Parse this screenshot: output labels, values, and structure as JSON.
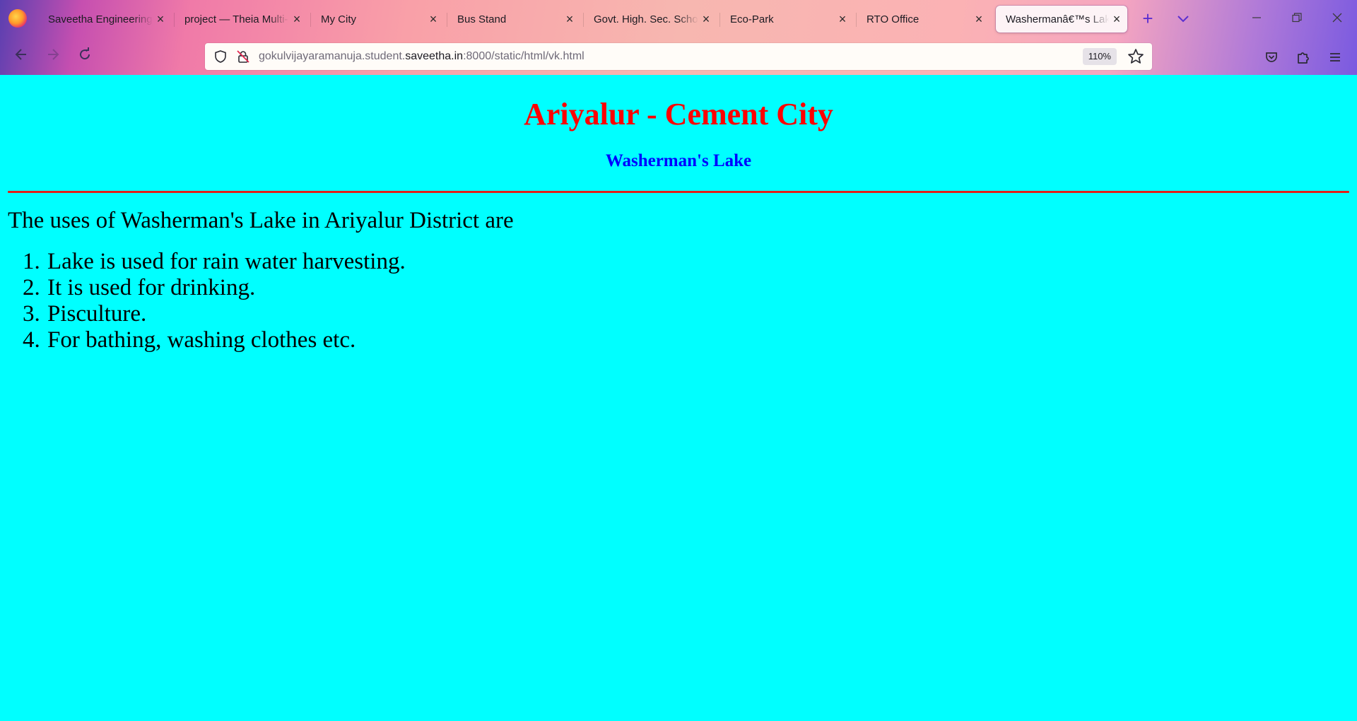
{
  "browser": {
    "tabs": [
      {
        "label": "Saveetha Engineering College",
        "active": false
      },
      {
        "label": "project — Theia Multi-Language",
        "active": false
      },
      {
        "label": "My City",
        "active": false
      },
      {
        "label": "Bus Stand",
        "active": false
      },
      {
        "label": "Govt. High. Sec. School",
        "active": false
      },
      {
        "label": "Eco-Park",
        "active": false
      },
      {
        "label": "RTO Office",
        "active": false
      },
      {
        "label": "Washermanâ€™s Lake",
        "active": true
      }
    ],
    "url": {
      "prefix": "gokulvijayaramanuja.student.",
      "host": "saveetha.in",
      "suffix": ":8000/static/html/vk.html"
    },
    "zoom": "110%",
    "accent": "#5b2fd0"
  },
  "page": {
    "title": "Ariyalur - Cement City",
    "subtitle": "Washerman's Lake",
    "intro": "The uses of Washerman's Lake in Ariyalur District are",
    "uses": [
      "Lake is used for rain water harvesting.",
      "It is used for drinking.",
      "Pisculture.",
      "For bathing, washing clothes etc."
    ],
    "colors": {
      "background": "#00ffff",
      "title": "#ff0000",
      "subtitle": "#0000ff",
      "rule": "#e0201a"
    }
  }
}
